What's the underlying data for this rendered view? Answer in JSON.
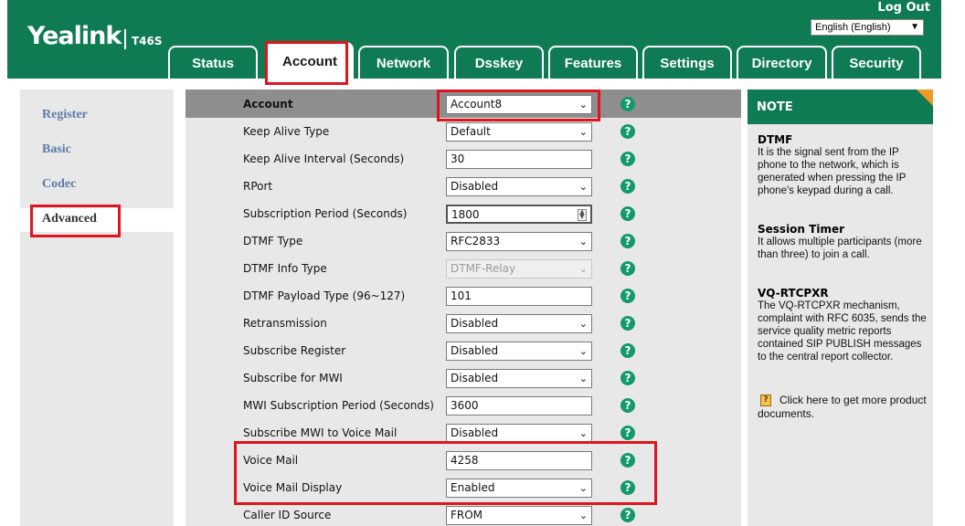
{
  "header": {
    "brand": "Yealink",
    "model": "T46S",
    "logout_label": "Log Out",
    "language": "English (English)",
    "tabs": [
      {
        "label": "Status"
      },
      {
        "label": "Account"
      },
      {
        "label": "Network"
      },
      {
        "label": "Dsskey"
      },
      {
        "label": "Features"
      },
      {
        "label": "Settings"
      },
      {
        "label": "Directory"
      },
      {
        "label": "Security"
      }
    ],
    "active_tab": "Account"
  },
  "sidebar": {
    "items": [
      {
        "label": "Register"
      },
      {
        "label": "Basic"
      },
      {
        "label": "Codec"
      },
      {
        "label": "Advanced"
      }
    ],
    "active": "Advanced"
  },
  "form": {
    "rows": [
      {
        "label": "Account",
        "type": "select",
        "value": "Account8"
      },
      {
        "label": "Keep Alive Type",
        "type": "select",
        "value": "Default"
      },
      {
        "label": "Keep Alive Interval (Seconds)",
        "type": "input",
        "value": "30"
      },
      {
        "label": "RPort",
        "type": "select",
        "value": "Disabled"
      },
      {
        "label": "Subscription Period (Seconds)",
        "type": "spin",
        "value": "1800"
      },
      {
        "label": "DTMF Type",
        "type": "select",
        "value": "RFC2833"
      },
      {
        "label": "DTMF Info Type",
        "type": "select-disabled",
        "value": "DTMF-Relay"
      },
      {
        "label": "DTMF Payload Type (96~127)",
        "type": "input",
        "value": "101"
      },
      {
        "label": "Retransmission",
        "type": "select",
        "value": "Disabled"
      },
      {
        "label": "Subscribe Register",
        "type": "select",
        "value": "Disabled"
      },
      {
        "label": "Subscribe for MWI",
        "type": "select",
        "value": "Disabled"
      },
      {
        "label": "MWI Subscription Period (Seconds)",
        "type": "input",
        "value": "3600"
      },
      {
        "label": "Subscribe MWI to Voice Mail",
        "type": "select",
        "value": "Disabled"
      },
      {
        "label": "Voice Mail",
        "type": "input",
        "value": "4258"
      },
      {
        "label": "Voice Mail Display",
        "type": "select",
        "value": "Enabled"
      },
      {
        "label": "Caller ID Source",
        "type": "select",
        "value": "FROM"
      }
    ],
    "help_glyph": "?"
  },
  "note": {
    "header": "NOTE",
    "sections": [
      {
        "title": "DTMF",
        "text": "It is the signal sent from the IP phone to the network, which is generated when pressing the IP phone's keypad during a call."
      },
      {
        "title": "Session Timer",
        "text": "It allows multiple participants (more than three) to join a call."
      },
      {
        "title": "VQ-RTCPXR",
        "text": "The VQ-RTCPXR mechanism, complaint with RFC 6035, sends the service quality metric reports contained SIP PUBLISH messages to the central report collector."
      }
    ],
    "doc_link": "Click here to get more product documents."
  },
  "colors": {
    "brand_green": "#0f7b52",
    "highlight_red": "#e0141e",
    "help_green": "#139a6a",
    "note_corner": "#f19a2b"
  },
  "icons": {
    "dropdown": "chevron-down-icon",
    "help": "help-question-icon",
    "document": "document-icon"
  }
}
